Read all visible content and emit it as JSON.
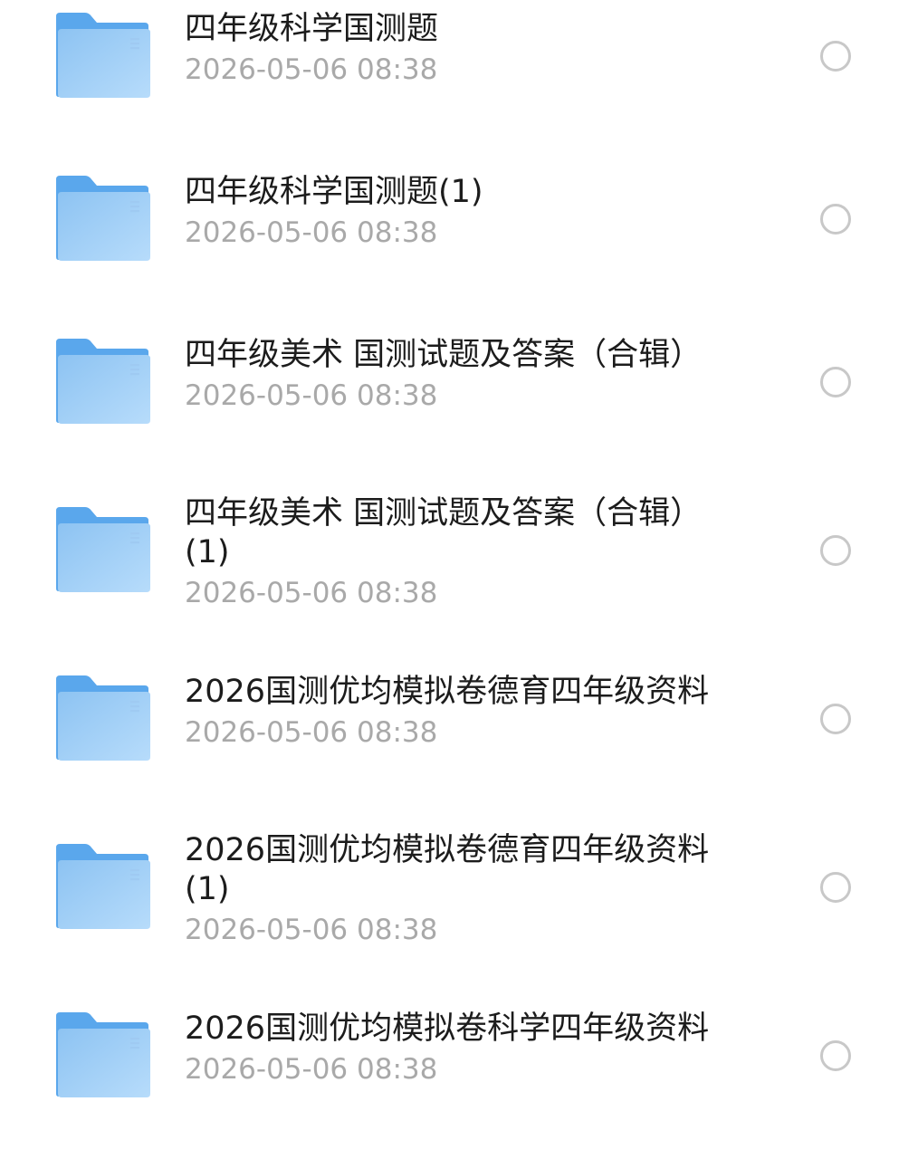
{
  "list": {
    "items": [
      {
        "name": "四年级科学国测题",
        "date": "2026-05-06 08:38",
        "icon": "folder-icon",
        "selected": false
      },
      {
        "name": "四年级科学国测题(1)",
        "date": "2026-05-06 08:38",
        "icon": "folder-icon",
        "selected": false
      },
      {
        "name": "四年级美术 国测试题及答案（合辑）",
        "date": "2026-05-06 08:38",
        "icon": "folder-icon",
        "selected": false
      },
      {
        "name": "四年级美术 国测试题及答案（合辑）\n(1)",
        "date": "2026-05-06 08:38",
        "icon": "folder-icon",
        "selected": false
      },
      {
        "name": "2026国测优均模拟卷德育四年级资料",
        "date": "2026-05-06 08:38",
        "icon": "folder-icon",
        "selected": false
      },
      {
        "name": "2026国测优均模拟卷德育四年级资料\n(1)",
        "date": "2026-05-06 08:38",
        "icon": "folder-icon",
        "selected": false
      },
      {
        "name": "2026国测优均模拟卷科学四年级资料",
        "date": "2026-05-06 08:38",
        "icon": "folder-icon",
        "selected": false
      }
    ]
  },
  "colors": {
    "folder_back": "#5aa7ec",
    "folder_front_top": "#8dc3f2",
    "folder_front_bottom": "#b7dcfb",
    "title_text": "#1c1c1c",
    "date_text": "#a9a9a9",
    "radio_border": "#c8c8c8"
  }
}
